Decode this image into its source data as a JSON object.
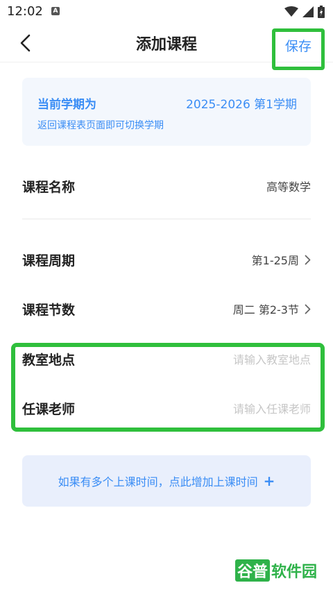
{
  "status_bar": {
    "time": "12:02",
    "notif_icon": "A"
  },
  "header": {
    "title": "添加课程",
    "save_label": "保存"
  },
  "semester": {
    "title": "当前学期为",
    "value": "2025-2026  第1学期",
    "hint": "返回课程表页面即可切换学期"
  },
  "form": {
    "course_name": {
      "label": "课程名称",
      "value": "高等数学"
    },
    "course_period": {
      "label": "课程周期",
      "value": "第1-25周"
    },
    "course_sections": {
      "label": "课程节数",
      "value": "周二 第2-3节"
    },
    "classroom": {
      "label": "教室地点",
      "placeholder": "请输入教室地点"
    },
    "teacher": {
      "label": "任课老师",
      "placeholder": "请输入任课老师"
    }
  },
  "add_time": {
    "label": "如果有多个上课时间，点此增加上课时间",
    "icon": "plus-icon"
  },
  "watermark": {
    "part1": "谷普",
    "part2": "软件园"
  },
  "colors": {
    "accent": "#3a8df5",
    "highlight": "#2fbf3c",
    "card_bg": "#f3f7fd"
  }
}
